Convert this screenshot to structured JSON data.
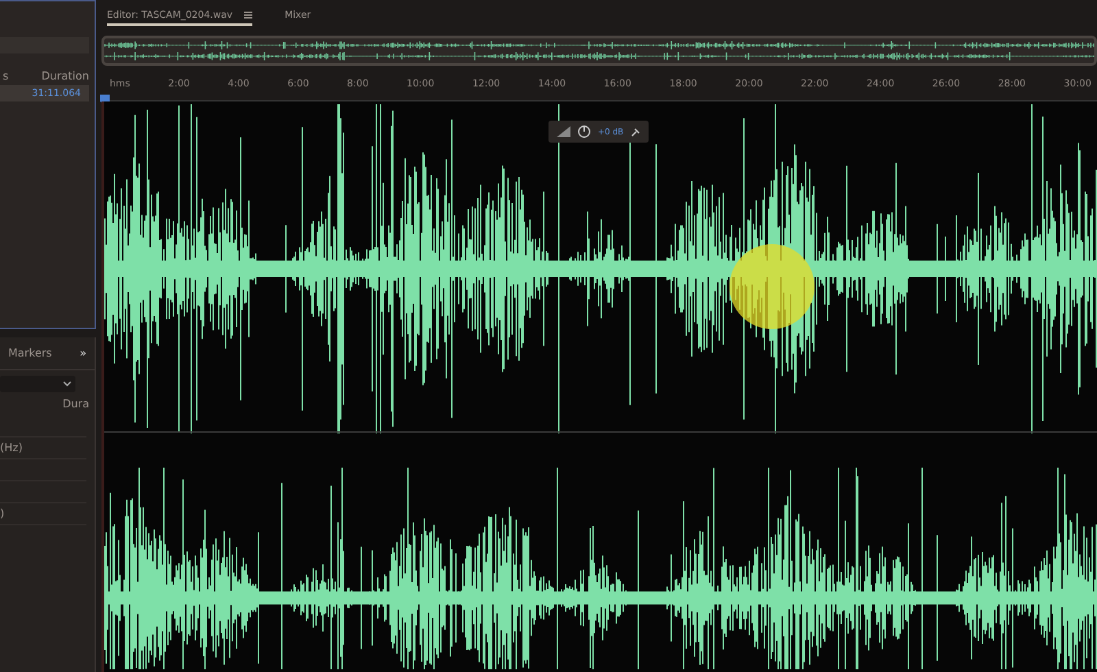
{
  "files_panel": {
    "columns": [
      "s",
      "Duration"
    ],
    "rows": [
      {
        "duration": "31:11.064",
        "selected": true
      }
    ]
  },
  "markers_panel": {
    "tab": "Markers",
    "more": "»",
    "column": "Dura",
    "rows": [
      "",
      "(Hz)",
      "",
      "",
      ")"
    ]
  },
  "editor": {
    "tabs": [
      {
        "label": "Editor: TASCAM_0204.wav",
        "selected": true
      },
      {
        "label": "Mixer",
        "selected": false
      }
    ],
    "ruler": [
      "hms",
      "2:00",
      "4:00",
      "6:00",
      "8:00",
      "10:00",
      "12:00",
      "14:00",
      "16:00",
      "18:00",
      "20:00",
      "22:00",
      "24:00",
      "26:00",
      "28:00",
      "30:00"
    ],
    "hud": {
      "gain": "+0 dB"
    }
  }
}
